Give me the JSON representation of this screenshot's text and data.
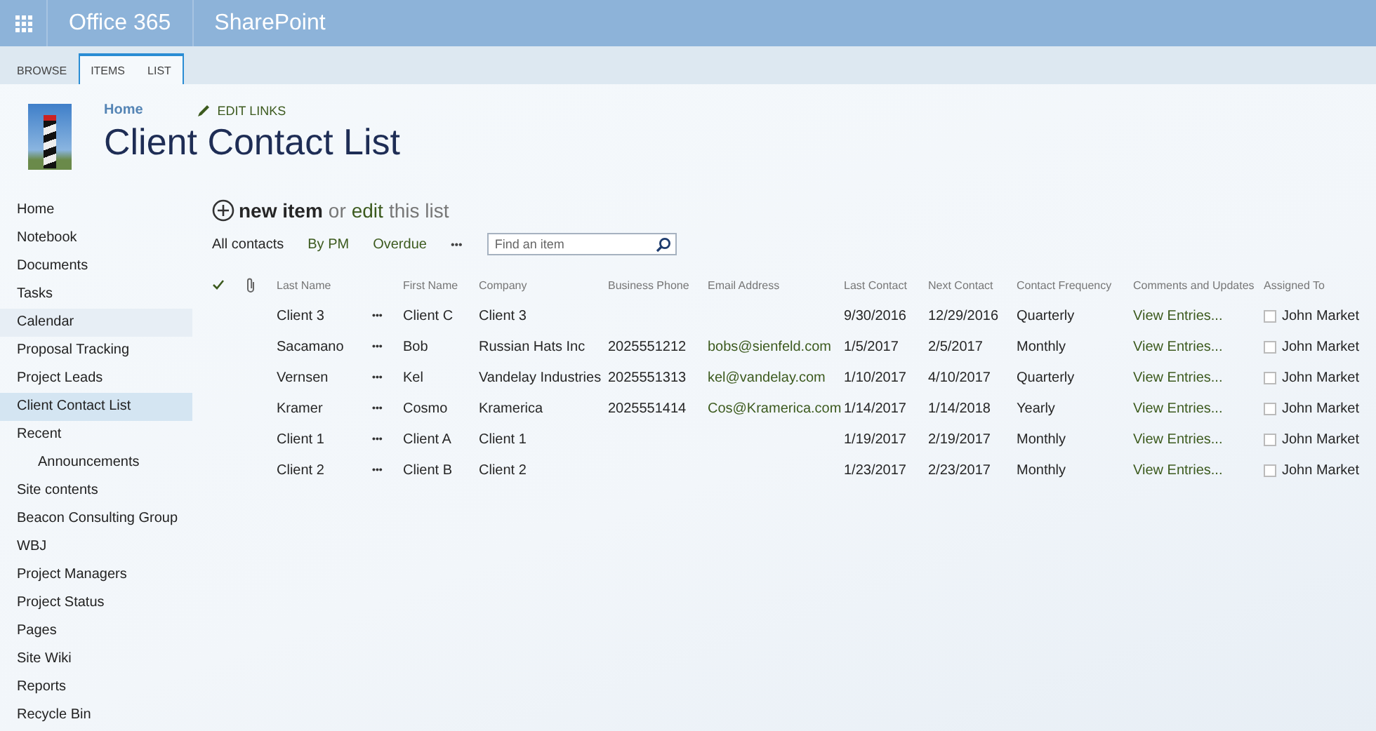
{
  "top_bar": {
    "product": "Office 365",
    "app": "SharePoint"
  },
  "ribbon_tabs": [
    {
      "label": "BROWSE",
      "selected": false
    },
    {
      "label": "ITEMS",
      "selected": true
    },
    {
      "label": "LIST",
      "selected": true
    }
  ],
  "breadcrumb": {
    "home": "Home",
    "edit_links": "EDIT LINKS"
  },
  "page_title": "Client Contact List",
  "sidebar": {
    "items": [
      {
        "label": "Home",
        "selected": false,
        "highlighted": false
      },
      {
        "label": "Notebook",
        "selected": false,
        "highlighted": false
      },
      {
        "label": "Documents",
        "selected": false,
        "highlighted": false
      },
      {
        "label": "Tasks",
        "selected": false,
        "highlighted": false
      },
      {
        "label": "Calendar",
        "selected": false,
        "highlighted": true
      },
      {
        "label": "Proposal Tracking",
        "selected": false,
        "highlighted": false
      },
      {
        "label": "Project Leads",
        "selected": false,
        "highlighted": false
      },
      {
        "label": "Client Contact List",
        "selected": true,
        "highlighted": false
      },
      {
        "label": "Recent",
        "selected": false,
        "highlighted": false,
        "children": [
          {
            "label": "Announcements",
            "selected": false,
            "highlighted": false
          }
        ]
      },
      {
        "label": "Site contents",
        "selected": false,
        "highlighted": false
      },
      {
        "label": "Beacon Consulting Group",
        "selected": false,
        "highlighted": false
      },
      {
        "label": "WBJ",
        "selected": false,
        "highlighted": false
      },
      {
        "label": "Project Managers",
        "selected": false,
        "highlighted": false
      },
      {
        "label": "Project Status",
        "selected": false,
        "highlighted": false
      },
      {
        "label": "Pages",
        "selected": false,
        "highlighted": false
      },
      {
        "label": "Site Wiki",
        "selected": false,
        "highlighted": false
      },
      {
        "label": "Reports",
        "selected": false,
        "highlighted": false
      },
      {
        "label": "Recycle Bin",
        "selected": false,
        "highlighted": false
      }
    ]
  },
  "command": {
    "new_item": "new item",
    "or": "or",
    "edit": "edit",
    "this_list": "this list"
  },
  "views": {
    "items": [
      {
        "label": "All contacts",
        "selected": true
      },
      {
        "label": "By PM",
        "selected": false
      },
      {
        "label": "Overdue",
        "selected": false
      }
    ],
    "more": "•••"
  },
  "search": {
    "placeholder": "Find an item"
  },
  "table": {
    "columns": [
      "Last Name",
      "First Name",
      "Company",
      "Business Phone",
      "Email Address",
      "Last Contact",
      "Next Contact",
      "Contact Frequency",
      "Comments and Updates",
      "Assigned To"
    ],
    "rows": [
      {
        "last_name": "Client 3",
        "menu": "•••",
        "first_name": "Client C",
        "company": "Client 3",
        "phone": "",
        "email": "",
        "last_contact": "9/30/2016",
        "next_contact": "12/29/2016",
        "frequency": "Quarterly",
        "comments": "View Entries...",
        "assigned_checked": false,
        "assigned_to": "John Market"
      },
      {
        "last_name": "Sacamano",
        "menu": "•••",
        "first_name": "Bob",
        "company": "Russian Hats Inc",
        "phone": "2025551212",
        "email": "bobs@sienfeld.com",
        "last_contact": "1/5/2017",
        "next_contact": "2/5/2017",
        "frequency": "Monthly",
        "comments": "View Entries...",
        "assigned_checked": false,
        "assigned_to": "John Market"
      },
      {
        "last_name": "Vernsen",
        "menu": "•••",
        "first_name": "Kel",
        "company": "Vandelay Industries",
        "phone": "2025551313",
        "email": "kel@vandelay.com",
        "last_contact": "1/10/2017",
        "next_contact": "4/10/2017",
        "frequency": "Quarterly",
        "comments": "View Entries...",
        "assigned_checked": false,
        "assigned_to": "John Market"
      },
      {
        "last_name": "Kramer",
        "menu": "•••",
        "first_name": "Cosmo",
        "company": "Kramerica",
        "phone": "2025551414",
        "email": "Cos@Kramerica.com",
        "last_contact": "1/14/2017",
        "next_contact": "1/14/2018",
        "frequency": "Yearly",
        "comments": "View Entries...",
        "assigned_checked": false,
        "assigned_to": "John Market"
      },
      {
        "last_name": "Client 1",
        "menu": "•••",
        "first_name": "Client A",
        "company": "Client 1",
        "phone": "",
        "email": "",
        "last_contact": "1/19/2017",
        "next_contact": "2/19/2017",
        "frequency": "Monthly",
        "comments": "View Entries...",
        "assigned_checked": false,
        "assigned_to": "John Market"
      },
      {
        "last_name": "Client 2",
        "menu": "•••",
        "first_name": "Client B",
        "company": "Client 2",
        "phone": "",
        "email": "",
        "last_contact": "1/23/2017",
        "next_contact": "2/23/2017",
        "frequency": "Monthly",
        "comments": "View Entries...",
        "assigned_checked": false,
        "assigned_to": "John Market"
      }
    ]
  }
}
